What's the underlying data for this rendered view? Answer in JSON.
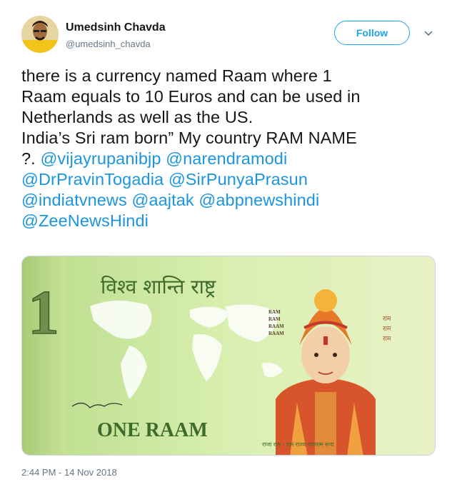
{
  "user": {
    "name": "Umedsinh Chavda",
    "handle": "@umedsinh_chavda",
    "follow_label": "Follow"
  },
  "tweet": {
    "lines": [
      [
        {
          "t": "there is a currency named Raam where 1",
          "m": false
        }
      ],
      [
        {
          "t": "Raam equals to 10 Euros and can be used in",
          "m": false
        }
      ],
      [
        {
          "t": "Netherlands as well as the US.",
          "m": false
        }
      ],
      [
        {
          "t": "India’s Sri ram born” My country RAM NAME",
          "m": false
        }
      ],
      [
        {
          "t": "?. ",
          "m": false
        },
        {
          "t": "@vijayrupanibjp",
          "m": true
        },
        {
          "t": " ",
          "m": false
        },
        {
          "t": "@narendramodi",
          "m": true
        }
      ],
      [
        {
          "t": "@DrPravinTogadia",
          "m": true
        },
        {
          "t": " ",
          "m": false
        },
        {
          "t": "@SirPunyaPrasun",
          "m": true
        }
      ],
      [
        {
          "t": "@indiatvnews",
          "m": true
        },
        {
          "t": " ",
          "m": false
        },
        {
          "t": "@aajtak",
          "m": true
        },
        {
          "t": " ",
          "m": false
        },
        {
          "t": "@abpnewshindi",
          "m": true
        }
      ],
      [
        {
          "t": "@ZeeNewsHindi",
          "m": true
        }
      ]
    ]
  },
  "banknote": {
    "numeral": "1",
    "top_script": "विश्व शान्ति राष्ट्र",
    "denomination": "ONE RAAM",
    "left_column": [
      "RAM",
      "RAM",
      "RAAM",
      "RAAM"
    ],
    "right_column": [
      "राम",
      "राम",
      "राम"
    ],
    "bottom_script": "राजा राम - राम राज्य परमात्म रूपा",
    "colors": {
      "note_green": "#c9e39a",
      "numeral_green": "#6f8f4c",
      "text_green": "#3e6a2c",
      "headdress": "#e9772a",
      "robe": "#d8542a"
    }
  },
  "timestamp": "2:44 PM - 14 Nov 2018",
  "colors": {
    "link": "#1b95e0",
    "follow": "#1da1f2",
    "secondary": "#657786"
  }
}
